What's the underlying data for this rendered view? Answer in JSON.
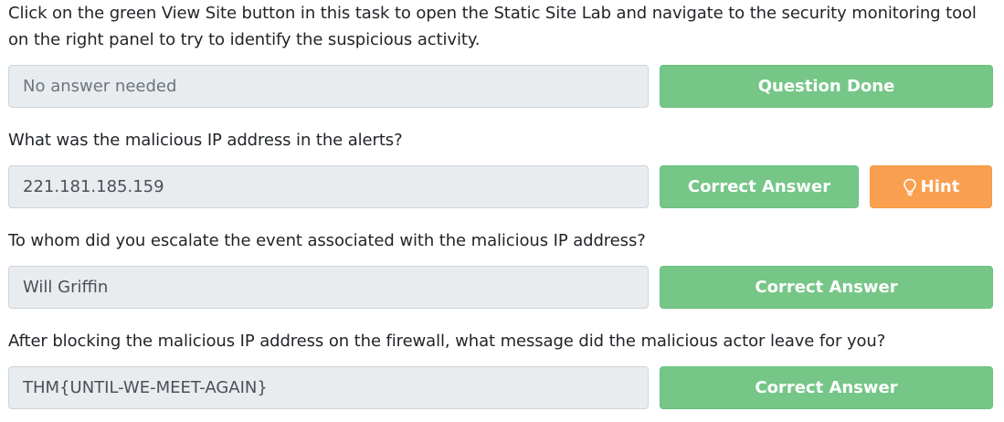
{
  "questions": [
    {
      "text": "Click on the green View Site button in this task to open the Static Site Lab and navigate to the security monitoring tool on the right panel to try to identify the suspicious activity.",
      "answer": "No answer needed",
      "button": "Question Done"
    },
    {
      "text": "What was the malicious IP address in the alerts?",
      "answer": "221.181.185.159",
      "button": "Correct Answer",
      "hint": "Hint"
    },
    {
      "text": "To whom did you escalate the event associated with the malicious IP address?",
      "answer": "Will Griffin",
      "button": "Correct Answer"
    },
    {
      "text": "After blocking the malicious IP address on the firewall, what message did the malicious actor leave for you?",
      "answer": "THM{UNTIL-WE-MEET-AGAIN}",
      "button": "Correct Answer"
    }
  ],
  "colors": {
    "success": "#75c687",
    "warning": "#f9a050",
    "input_bg": "#e9ecef"
  },
  "icons": {
    "hint": "lightbulb-icon"
  }
}
